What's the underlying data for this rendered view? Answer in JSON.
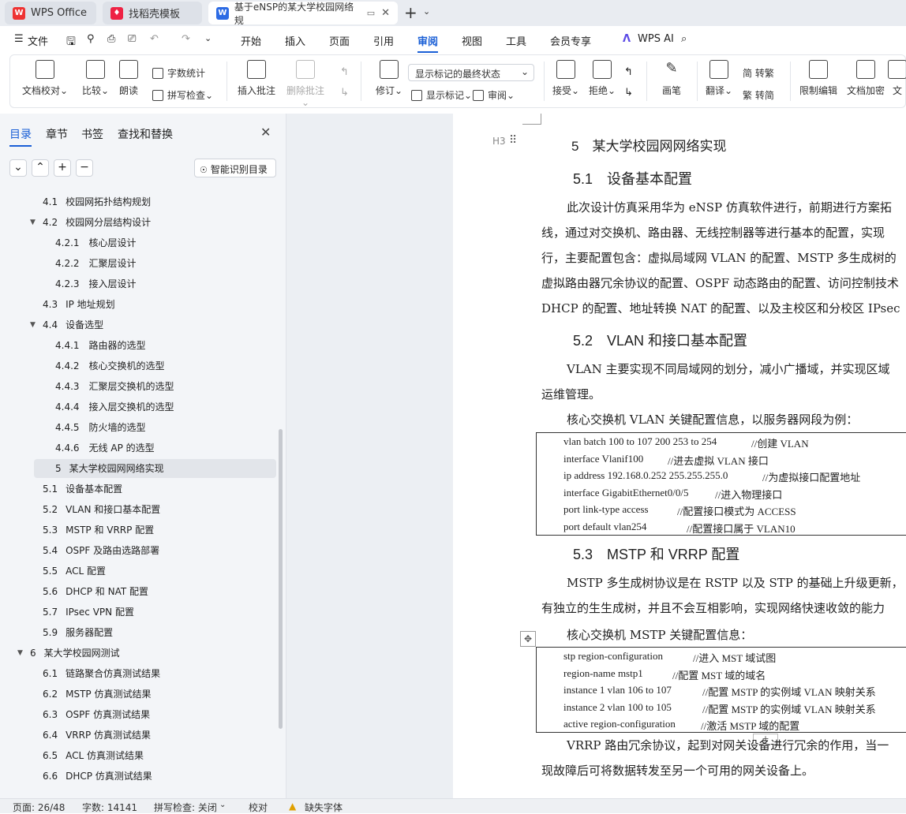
{
  "tabs": [
    {
      "label": "WPS Office",
      "icon": "wps-logo-icon"
    },
    {
      "label": "找稻壳模板",
      "icon": "daoke-icon"
    },
    {
      "label": "基于eNSP的某大学校园网络规",
      "icon": "word-doc-icon"
    }
  ],
  "menu": {
    "file": "文件",
    "items": [
      "开始",
      "插入",
      "页面",
      "引用",
      "审阅",
      "视图",
      "工具",
      "会员专享"
    ],
    "ai": "WPS AI"
  },
  "ribbon": {
    "doc_check": "文档校对",
    "compare": "比较",
    "read": "朗读",
    "word_count": "字数统计",
    "spell_check": "拼写检查",
    "insert_comment": "插入批注",
    "delete_comment": "删除批注",
    "revise": "修订",
    "show_markup": "显示标记",
    "review": "审阅",
    "markup_state": "显示标记的最终状态",
    "accept": "接受",
    "reject": "拒绝",
    "pen": "画笔",
    "translate": "翻译",
    "trad": "简 转繁",
    "simp": "繁 转简",
    "restrict": "限制编辑",
    "encrypt": "文档加密",
    "more": "文"
  },
  "nav": {
    "tabs": [
      "目录",
      "章节",
      "书签",
      "查找和替换"
    ],
    "smart": "智能识别目录",
    "items": [
      {
        "num": "4.1",
        "text": "校园网拓扑结构规划"
      },
      {
        "num": "4.2",
        "text": "校园网分层结构设计"
      },
      {
        "num": "4.2.1",
        "text": "核心层设计"
      },
      {
        "num": "4.2.2",
        "text": "汇聚层设计"
      },
      {
        "num": "4.2.3",
        "text": "接入层设计"
      },
      {
        "num": "4.3",
        "text": "IP 地址规划"
      },
      {
        "num": "4.4",
        "text": "设备选型"
      },
      {
        "num": "4.4.1",
        "text": "路由器的选型"
      },
      {
        "num": "4.4.2",
        "text": "核心交换机的选型"
      },
      {
        "num": "4.4.3",
        "text": "汇聚层交换机的选型"
      },
      {
        "num": "4.4.4",
        "text": "接入层交换机的选型"
      },
      {
        "num": "4.4.5",
        "text": "防火墙的选型"
      },
      {
        "num": "4.4.6",
        "text": "无线 AP 的选型"
      },
      {
        "num": "5",
        "text": "某大学校园网网络实现"
      },
      {
        "num": "5.1",
        "text": "设备基本配置"
      },
      {
        "num": "5.2",
        "text": "VLAN 和接口基本配置"
      },
      {
        "num": "5.3",
        "text": "MSTP 和 VRRP 配置"
      },
      {
        "num": "5.4",
        "text": "OSPF 及路由选路部署"
      },
      {
        "num": "5.5",
        "text": "ACL 配置"
      },
      {
        "num": "5.6",
        "text": "DHCP 和 NAT 配置"
      },
      {
        "num": "5.7",
        "text": "IPsec VPN 配置"
      },
      {
        "num": "5.9",
        "text": "服务器配置"
      },
      {
        "num": "6",
        "text": "某大学校园网测试"
      },
      {
        "num": "6.1",
        "text": "链路聚合仿真测试结果"
      },
      {
        "num": "6.2",
        "text": "MSTP 仿真测试结果"
      },
      {
        "num": "6.3",
        "text": "OSPF 仿真测试结果"
      },
      {
        "num": "6.4",
        "text": "VRRP 仿真测试结果"
      },
      {
        "num": "6.5",
        "text": "ACL 仿真测试结果"
      },
      {
        "num": "6.6",
        "text": "DHCP 仿真测试结果"
      }
    ]
  },
  "doc": {
    "h_style": "H3",
    "h5": "5　某大学校园网网络实现",
    "h51": "5.1　设备基本配置",
    "p1": [
      "此次设计仿真采用华为 eNSP 仿真软件进行，前期进行方案拓",
      "线，通过对交换机、路由器、无线控制器等进行基本的配置，实现",
      "行，主要配置包含：虚拟局域网 VLAN 的配置、MSTP 多生成树的",
      "虚拟路由器冗余协议的配置、OSPF 动态路由的配置、访问控制技术",
      "DHCP 的配置、地址转换 NAT 的配置、以及主校区和分校区 IPsec"
    ],
    "h52": "5.2　VLAN 和接口基本配置",
    "p2": [
      "VLAN 主要实现不同局域网的划分，减小广播域，并实现区域",
      "运维管理。"
    ],
    "p3": "核心交换机 VLAN 关键配置信息，以服务器网段为例：",
    "code1": [
      {
        "c": "vlan batch 100 to 107 200 253 to 254",
        "m": "//创建 VLAN"
      },
      {
        "c": "interface Vlanif100",
        "m": "//进去虚拟 VLAN 接口"
      },
      {
        "c": "ip address 192.168.0.252 255.255.255.0",
        "m": "//为虚拟接口配置地址"
      },
      {
        "c": "interface GigabitEthernet0/0/5",
        "m": "//进入物理接口"
      },
      {
        "c": "port link-type access",
        "m": "//配置接口模式为 ACCESS"
      },
      {
        "c": "port default vlan254",
        "m": "//配置接口属于 VLAN10"
      }
    ],
    "h53": "5.3　MSTP 和 VRRP 配置",
    "p4": [
      "MSTP 多生成树协议是在 RSTP 以及 STP 的基础上升级更新，",
      "有独立的生生成树，并且不会互相影响，实现网络快速收敛的能力"
    ],
    "p5": "核心交换机 MSTP 关键配置信息：",
    "code2": [
      {
        "c": "stp region-configuration",
        "m": "//进入 MST 域试图"
      },
      {
        "c": "region-name mstp1",
        "m": "//配置 MST 域的域名"
      },
      {
        "c": "instance 1 vlan 106 to 107",
        "m": "//配置 MSTP 的实例域 VLAN 映射关系"
      },
      {
        "c": "instance 2 vlan 100 to 105",
        "m": "//配置 MSTP 的实例域 VLAN 映射关系"
      },
      {
        "c": "active region-configuration",
        "m": "//激活 MSTP 域的配置"
      }
    ],
    "p6": [
      "VRRP 路由冗余协议，起到对网关设备进行冗余的作用，当一",
      "现故障后可将数据转发至另一个可用的网关设备上。"
    ]
  },
  "status": {
    "page": "页面: 26/48",
    "words": "字数: 14141",
    "spell": "拼写检查: 关闭",
    "proof": "校对",
    "font": "缺失字体"
  }
}
